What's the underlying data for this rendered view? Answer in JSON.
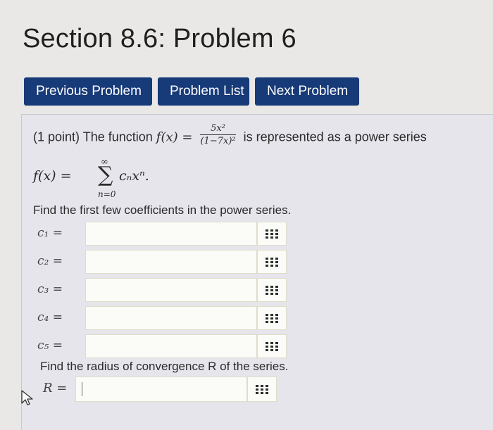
{
  "page": {
    "title": "Section 8.6: Problem 6"
  },
  "nav": {
    "previous": "Previous Problem",
    "list": "Problem List",
    "next": "Next Problem"
  },
  "problem": {
    "intro": "(1 point) The function",
    "func_lhs": "f(x) =",
    "numerator": "5x²",
    "denominator": "(1−7x)²",
    "tail": "is represented as a power series",
    "series_lhs": "f(x) =",
    "sum_sym": "∑",
    "sum_upper": "∞",
    "sum_lower": "n=0",
    "series_term": "cₙxⁿ.",
    "prompt": "Find the first few coefficients in the power series.",
    "coefficients": [
      {
        "label": "c₁ =",
        "value": ""
      },
      {
        "label": "c₂ =",
        "value": ""
      },
      {
        "label": "c₃ =",
        "value": ""
      },
      {
        "label": "c₄ =",
        "value": ""
      },
      {
        "label": "c₅ =",
        "value": ""
      }
    ],
    "radius_prompt": "Find the radius of convergence R of the series.",
    "radius_label": "R =",
    "radius_value": ""
  },
  "icons": {
    "equation_editor": "grid-icon",
    "cursor": "mouse-pointer-icon"
  }
}
